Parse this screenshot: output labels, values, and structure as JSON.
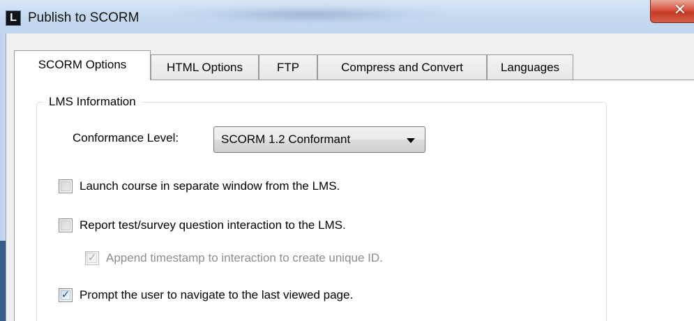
{
  "window": {
    "title": "Publish to SCORM",
    "icon_letter": "L",
    "close_glyph": "✕"
  },
  "tabs": [
    {
      "label": "SCORM Options",
      "active": true
    },
    {
      "label": "HTML Options",
      "active": false
    },
    {
      "label": "FTP",
      "active": false
    },
    {
      "label": "Compress and Convert",
      "active": false
    },
    {
      "label": "Languages",
      "active": false
    }
  ],
  "lms": {
    "group_label": "LMS Information",
    "conformance_label": "Conformance Level:",
    "conformance_value": "SCORM 1.2 Conformant"
  },
  "options": [
    {
      "label": "Launch course in separate window from the LMS.",
      "checked": false,
      "enabled": true
    },
    {
      "label": "Report test/survey question interaction to the LMS.",
      "checked": false,
      "enabled": true
    },
    {
      "label": "Append timestamp to interaction to create unique ID.",
      "checked": true,
      "enabled": false
    },
    {
      "label": "Prompt the user to navigate to the last viewed page.",
      "checked": true,
      "enabled": true
    }
  ],
  "check_glyph": "✓",
  "colors": {
    "title_bar": "#c7dbf0",
    "close_button": "#d9533f",
    "disabled_text": "#8d8d8d",
    "check_mark": "#2a4f86"
  }
}
